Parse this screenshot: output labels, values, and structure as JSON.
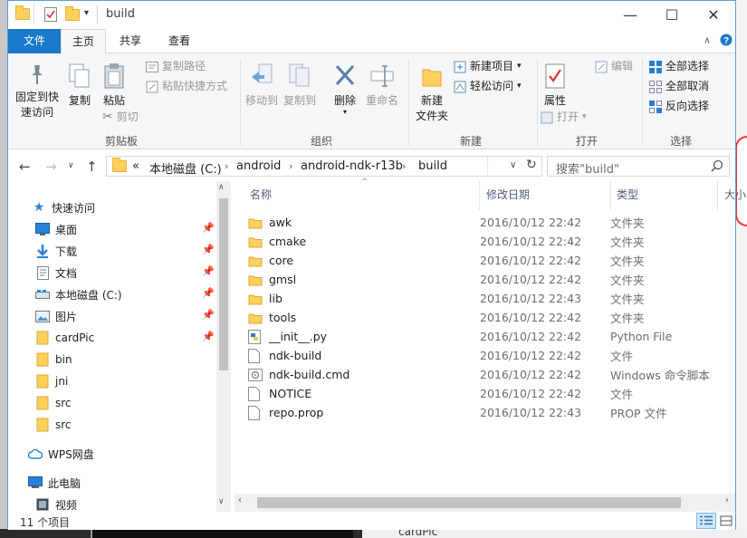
{
  "window": {
    "title": "build",
    "caption": {
      "minimize": "—",
      "maximize": "☐",
      "close": "✕"
    }
  },
  "tabs": [
    {
      "label": "文件"
    },
    {
      "label": "主页"
    },
    {
      "label": "共享"
    },
    {
      "label": "查看"
    }
  ],
  "ribbon": {
    "pin_quick_access": "固定到快\n速访问",
    "copy": "复制",
    "paste": "粘贴",
    "copy_path": "复制路径",
    "paste_shortcut": "粘贴快捷方式",
    "cut": "剪切",
    "group_clipboard": "剪贴板",
    "move_to": "移动到",
    "copy_to": "复制到",
    "delete": "删除",
    "rename": "重命名",
    "group_organize": "组织",
    "new_folder": "新建\n文件夹",
    "new_item": "新建项目",
    "easy_access": "轻松访问",
    "group_new": "新建",
    "properties": "属性",
    "open": "打开",
    "edit": "编辑",
    "group_open": "打开",
    "select_all": "全部选择",
    "select_none": "全部取消",
    "invert_selection": "反向选择",
    "group_select": "选择"
  },
  "address": {
    "overflow": "«",
    "crumbs": [
      "本地磁盘 (C:)",
      "android",
      "android-ndk-r13b",
      "build"
    ]
  },
  "search": {
    "placeholder": "搜索\"build\""
  },
  "nav_pane": {
    "items": [
      {
        "label": "快速访问",
        "icon": "star-icon",
        "pinned": false
      },
      {
        "label": "桌面",
        "icon": "desktop-icon",
        "pinned": true
      },
      {
        "label": "下载",
        "icon": "download-icon",
        "pinned": true
      },
      {
        "label": "文档",
        "icon": "document-icon",
        "pinned": true
      },
      {
        "label": "本地磁盘 (C:)",
        "icon": "drive-icon",
        "pinned": true
      },
      {
        "label": "图片",
        "icon": "pictures-icon",
        "pinned": true
      },
      {
        "label": "cardPic",
        "icon": "folder-icon",
        "pinned": true
      },
      {
        "label": "bin",
        "icon": "folder-icon",
        "pinned": false
      },
      {
        "label": "jni",
        "icon": "folder-icon",
        "pinned": false
      },
      {
        "label": "src",
        "icon": "folder-icon",
        "pinned": false
      },
      {
        "label": "src",
        "icon": "folder-icon",
        "pinned": false
      },
      {
        "label": "WPS网盘",
        "icon": "cloud-icon",
        "pinned": false
      },
      {
        "label": "此电脑",
        "icon": "computer-icon",
        "pinned": false
      },
      {
        "label": "视频",
        "icon": "video-icon",
        "pinned": false
      }
    ]
  },
  "columns": {
    "name": "名称",
    "date": "修改日期",
    "type": "类型",
    "size": "大小"
  },
  "files": [
    {
      "name": "awk",
      "date": "2016/10/12 22:42",
      "type": "文件夹",
      "icon": "folder-icon"
    },
    {
      "name": "cmake",
      "date": "2016/10/12 22:42",
      "type": "文件夹",
      "icon": "folder-icon"
    },
    {
      "name": "core",
      "date": "2016/10/12 22:42",
      "type": "文件夹",
      "icon": "folder-icon"
    },
    {
      "name": "gmsl",
      "date": "2016/10/12 22:42",
      "type": "文件夹",
      "icon": "folder-icon"
    },
    {
      "name": "lib",
      "date": "2016/10/12 22:43",
      "type": "文件夹",
      "icon": "folder-icon"
    },
    {
      "name": "tools",
      "date": "2016/10/12 22:42",
      "type": "文件夹",
      "icon": "folder-icon"
    },
    {
      "name": "__init__.py",
      "date": "2016/10/12 22:42",
      "type": "Python File",
      "icon": "python-file-icon"
    },
    {
      "name": "ndk-build",
      "date": "2016/10/12 22:42",
      "type": "文件",
      "icon": "file-icon"
    },
    {
      "name": "ndk-build.cmd",
      "date": "2016/10/12 22:42",
      "type": "Windows 命令脚本",
      "icon": "cmd-file-icon"
    },
    {
      "name": "NOTICE",
      "date": "2016/10/12 22:42",
      "type": "文件",
      "icon": "file-icon"
    },
    {
      "name": "repo.prop",
      "date": "2016/10/12 22:43",
      "type": "PROP 文件",
      "icon": "file-icon"
    }
  ],
  "status": {
    "item_count": "11 个项目"
  },
  "background": {
    "taskbar_folder": "cardPic"
  },
  "colors": {
    "accent": "#1979ca",
    "folder": "#ffd05b"
  }
}
